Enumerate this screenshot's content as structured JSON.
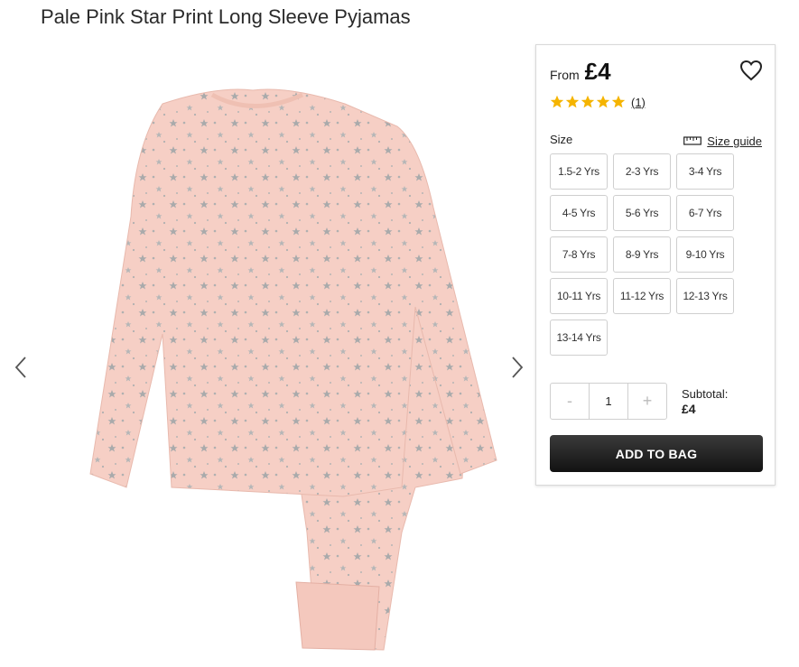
{
  "product": {
    "title": "Pale Pink Star Print Long Sleeve Pyjamas"
  },
  "gallery": {
    "prev_icon": "chevron-left-icon",
    "next_icon": "chevron-right-icon",
    "image_icon": "pyjama-product-image"
  },
  "panel": {
    "from_label": "From",
    "price": "£4",
    "wishlist_icon": "heart-icon",
    "rating": {
      "stars": 5,
      "max": 5,
      "review_count": "(1)",
      "star_color": "#f5b400"
    },
    "size_label": "Size",
    "size_guide_label": "Size guide",
    "sizes": [
      "1.5-2 Yrs",
      "2-3 Yrs",
      "3-4 Yrs",
      "4-5 Yrs",
      "5-6 Yrs",
      "6-7 Yrs",
      "7-8 Yrs",
      "8-9 Yrs",
      "9-10 Yrs",
      "10-11 Yrs",
      "11-12 Yrs",
      "12-13 Yrs",
      "13-14 Yrs"
    ],
    "quantity": {
      "minus": "-",
      "value": "1",
      "plus": "+"
    },
    "subtotal_label": "Subtotal:",
    "subtotal_value": "£4",
    "add_to_bag_label": "ADD TO BAG"
  }
}
